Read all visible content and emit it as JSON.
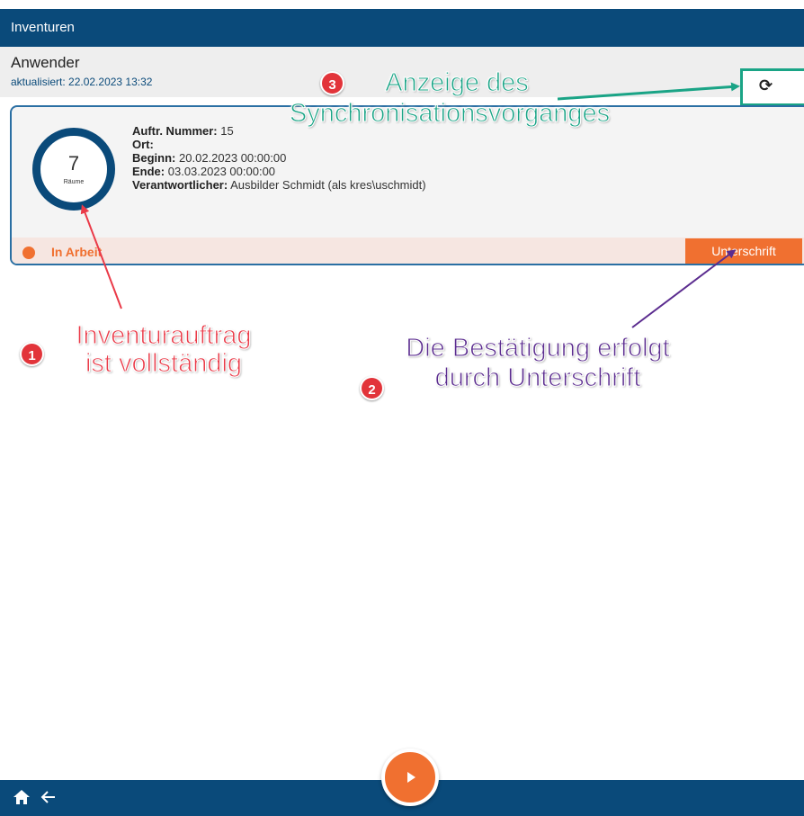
{
  "app": {
    "title": "Inventuren"
  },
  "user": {
    "name": "Anwender",
    "updated": "aktualisiert: 22.02.2023 13:32"
  },
  "sync": {
    "icon": "sync-icon"
  },
  "card": {
    "count": "7",
    "count_label": "Räume",
    "fields": [
      {
        "label": "Auftr. Nummer:",
        "value": "15"
      },
      {
        "label": "Ort:",
        "value": ""
      },
      {
        "label": "Beginn:",
        "value": "20.02.2023 00:00:00"
      },
      {
        "label": "Ende:",
        "value": "03.03.2023 00:00:00"
      },
      {
        "label": "Verantwortlicher:",
        "value": "Ausbilder Schmidt (als kres\\uschmidt)"
      }
    ],
    "status": "In Arbeit",
    "status_color": "#f07030",
    "sign_button": "Unterschrift"
  },
  "annotations": {
    "a1": {
      "badge": "1",
      "line1": "Inventurauftrag",
      "line2": "ist vollständig",
      "color": "#ea3a48"
    },
    "a2": {
      "badge": "2",
      "line1": "Die Bestätigung erfolgt",
      "line2": "durch Unterschrift",
      "color": "#5b2c8f"
    },
    "a3": {
      "badge": "3",
      "line1": "Anzeige des",
      "line2": "Synchronisationsvorganges",
      "color": "#1aa486"
    }
  },
  "nav": {
    "home_icon": "home-icon",
    "back_icon": "back-arrow-icon",
    "fab_icon": "play-icon"
  },
  "colors": {
    "primary": "#0a4a7a",
    "accent": "#f07030"
  }
}
